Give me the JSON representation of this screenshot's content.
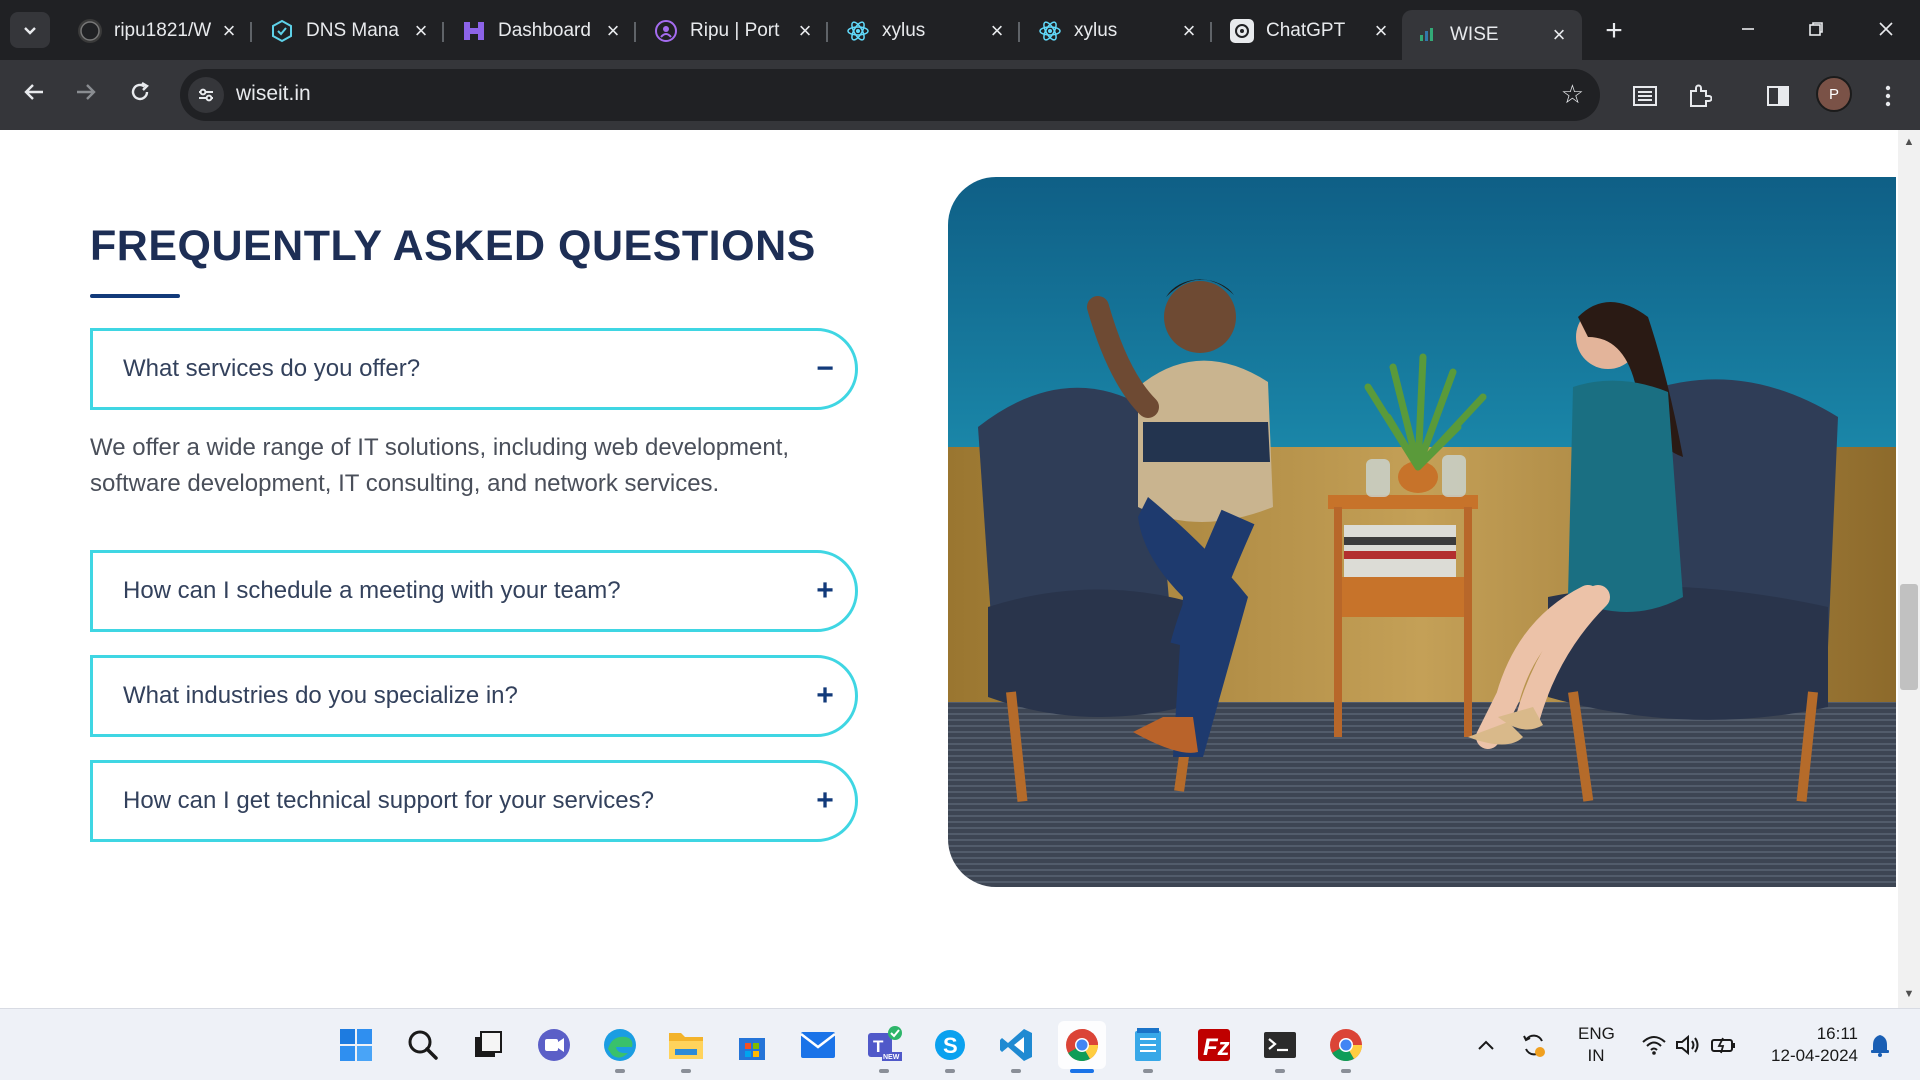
{
  "browser": {
    "tabs": [
      {
        "label": "ripu1821/W",
        "icon": "github-icon"
      },
      {
        "label": "DNS Mana",
        "icon": "dns-icon"
      },
      {
        "label": "Dashboard",
        "icon": "dashboard-icon"
      },
      {
        "label": "Ripu | Port",
        "icon": "portfolio-icon"
      },
      {
        "label": "xylus",
        "icon": "react-icon"
      },
      {
        "label": "xylus",
        "icon": "react-icon"
      },
      {
        "label": "ChatGPT",
        "icon": "chatgpt-icon"
      },
      {
        "label": "WISE",
        "icon": "wise-icon",
        "active": true
      }
    ],
    "new_tab_label": "+",
    "url": "wiseit.in",
    "profile_initial": "P"
  },
  "faq": {
    "title": "FREQUENTLY ASKED QUESTIONS",
    "items": [
      {
        "question": "What services do you offer?",
        "toggle": "−",
        "expanded": true
      },
      {
        "question": "How can I schedule a meeting with your team?",
        "toggle": "+"
      },
      {
        "question": "What industries do you specialize in?",
        "toggle": "+"
      },
      {
        "question": "How can I get technical support for your services?",
        "toggle": "+"
      }
    ],
    "answer": "We offer a wide range of IT solutions, including web development, software development, IT consulting, and network services."
  },
  "colors": {
    "title": "#1d2e55",
    "accent_border": "#3fd6e3",
    "toggle": "#123a7a"
  },
  "taskbar": {
    "apps": [
      "windows-start",
      "search",
      "task-view",
      "meet",
      "edge",
      "file-explorer",
      "store",
      "mail",
      "teams",
      "skype",
      "vscode",
      "chrome",
      "notepad",
      "filezilla",
      "terminal",
      "chrome-canary"
    ],
    "lang_top": "ENG",
    "lang_bottom": "IN",
    "time": "16:11",
    "date": "12-04-2024"
  }
}
